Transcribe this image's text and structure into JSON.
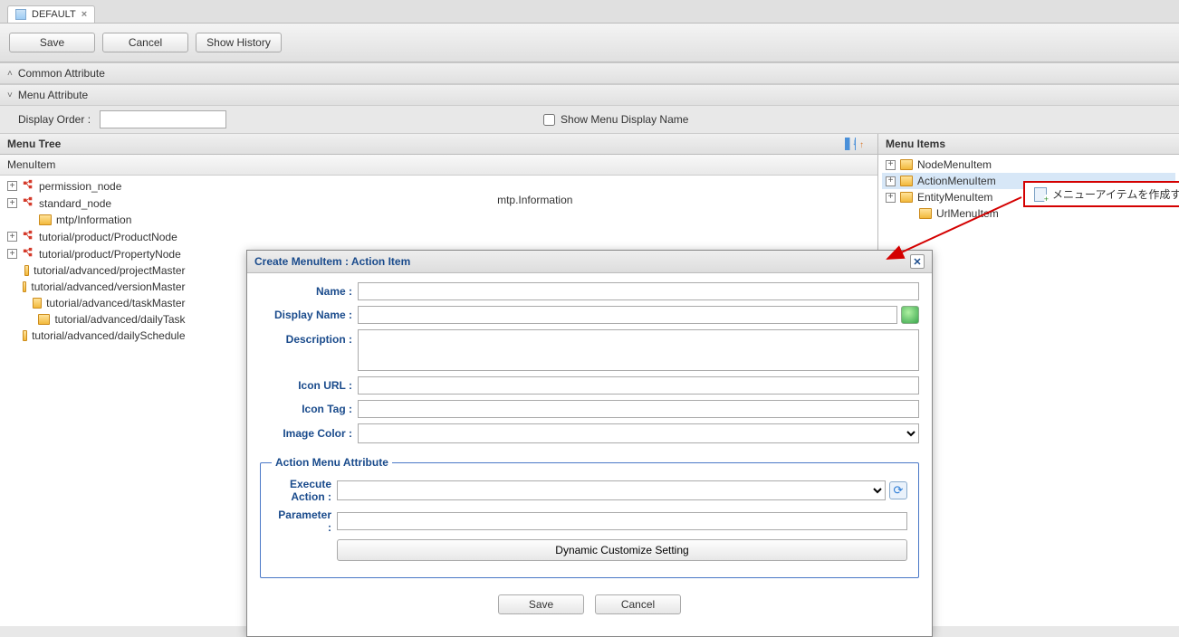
{
  "tab": {
    "title": "DEFAULT"
  },
  "toolbar": {
    "save": "Save",
    "cancel": "Cancel",
    "history": "Show History"
  },
  "sections": {
    "common": "Common Attribute",
    "menu": "Menu Attribute"
  },
  "menuAttr": {
    "displayOrderLabel": "Display Order :",
    "displayOrderValue": "",
    "showMenuLabel": "Show Menu Display Name"
  },
  "leftPanel": {
    "title": "Menu Tree",
    "gridHeader": "MenuItem",
    "selectedBreadcrumb": "mtp.Information",
    "tree": [
      {
        "icon": "red",
        "label": "permission_node",
        "expandable": true
      },
      {
        "icon": "red",
        "label": "standard_node",
        "expandable": true
      },
      {
        "icon": "folder",
        "label": "mtp/Information",
        "expandable": false,
        "indent": 1
      },
      {
        "icon": "red",
        "label": "tutorial/product/ProductNode",
        "expandable": true
      },
      {
        "icon": "red",
        "label": "tutorial/product/PropertyNode",
        "expandable": true
      },
      {
        "icon": "folder",
        "label": "tutorial/advanced/projectMaster",
        "expandable": false,
        "indent": 1
      },
      {
        "icon": "folder",
        "label": "tutorial/advanced/versionMaster",
        "expandable": false,
        "indent": 1
      },
      {
        "icon": "folder",
        "label": "tutorial/advanced/taskMaster",
        "expandable": false,
        "indent": 1
      },
      {
        "icon": "folder",
        "label": "tutorial/advanced/dailyTask",
        "expandable": false,
        "indent": 1
      },
      {
        "icon": "folder",
        "label": "tutorial/advanced/dailySchedule",
        "expandable": false,
        "indent": 1
      }
    ]
  },
  "rightPanel": {
    "title": "Menu Items",
    "items": [
      {
        "label": "NodeMenuItem",
        "expandable": true,
        "selected": false
      },
      {
        "label": "ActionMenuItem",
        "expandable": true,
        "selected": true
      },
      {
        "label": "EntityMenuItem",
        "expandable": true,
        "selected": false
      },
      {
        "label": "UrlMenuItem",
        "expandable": false,
        "indent": 1,
        "selected": false
      }
    ]
  },
  "dialog": {
    "title": "Create MenuItem : Action Item",
    "labels": {
      "name": "Name :",
      "displayName": "Display Name :",
      "description": "Description :",
      "iconUrl": "Icon URL :",
      "iconTag": "Icon Tag :",
      "imageColor": "Image Color :",
      "actionLegend": "Action Menu Attribute",
      "executeAction": "Execute Action :",
      "parameter": "Parameter :",
      "dynamic": "Dynamic Customize Setting",
      "save": "Save",
      "cancel": "Cancel"
    },
    "values": {
      "name": "",
      "displayName": "",
      "description": "",
      "iconUrl": "",
      "iconTag": "",
      "imageColor": "",
      "executeAction": "",
      "parameter": ""
    }
  },
  "callout": {
    "text": "メニューアイテムを作成する"
  }
}
